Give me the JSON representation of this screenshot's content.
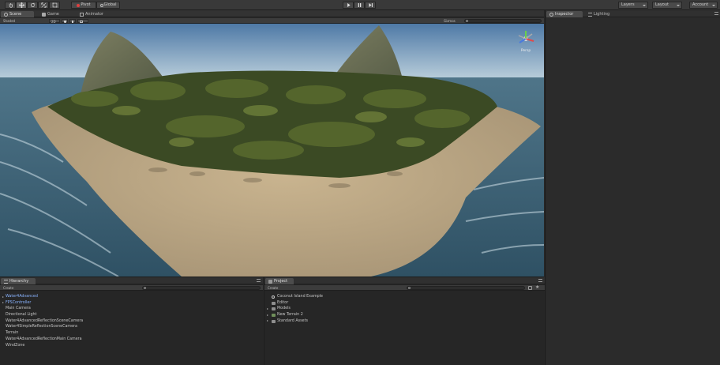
{
  "toolbar": {
    "transform_tools": [
      "hand-tool",
      "move-tool",
      "rotate-tool",
      "scale-tool",
      "rect-tool"
    ],
    "pivot_label": "Pivot",
    "global_label": "Global",
    "play_controls": [
      "play",
      "pause",
      "step"
    ],
    "layers_label": "Layers",
    "layout_label": "Layout",
    "account_label": "Account"
  },
  "scene_panel": {
    "tabs": [
      {
        "label": "Scene",
        "icon": "scene-icon"
      },
      {
        "label": "Game",
        "icon": "game-icon"
      },
      {
        "label": "Animator",
        "icon": "animator-icon"
      }
    ],
    "shading_mode": "Shaded",
    "mode_2d": "2D",
    "gizmos_label": "Gizmos",
    "gizmo_view": "Persp"
  },
  "hierarchy": {
    "tab_label": "Hierarchy",
    "create_label": "Create",
    "items": [
      {
        "label": "Water4Advanced",
        "prefab": true,
        "expandable": true
      },
      {
        "label": "FPSController",
        "prefab": true,
        "expandable": true
      },
      {
        "label": "Main Camera",
        "prefab": false,
        "expandable": false
      },
      {
        "label": "Directional Light",
        "prefab": false,
        "expandable": false
      },
      {
        "label": "Water4AdvancedReflectionSceneCamera",
        "prefab": false,
        "expandable": false
      },
      {
        "label": "Water4SimpleReflectionSceneCamera",
        "prefab": false,
        "expandable": false
      },
      {
        "label": "Terrain",
        "prefab": false,
        "expandable": false
      },
      {
        "label": "Water4AdvancedReflectionMain Camera",
        "prefab": false,
        "expandable": false
      },
      {
        "label": "WindZone",
        "prefab": false,
        "expandable": false
      }
    ]
  },
  "project": {
    "tab_label": "Project",
    "create_label": "Create",
    "items": [
      {
        "label": "Coconut Island Example",
        "icon": "unity-scene-icon",
        "expandable": false
      },
      {
        "label": "Editor",
        "icon": "folder-icon",
        "expandable": false
      },
      {
        "label": "Models",
        "icon": "folder-icon",
        "expandable": true
      },
      {
        "label": "New Terrain 2",
        "icon": "terrain-icon",
        "expandable": true
      },
      {
        "label": "Standard Assets",
        "icon": "folder-icon",
        "expandable": true
      }
    ]
  },
  "inspector": {
    "tabs": [
      {
        "label": "Inspector",
        "icon": "info-icon"
      },
      {
        "label": "Lighting",
        "icon": "lighting-icon"
      }
    ]
  },
  "colors": {
    "panel_bg": "#262626",
    "toolbar_bg": "#393939",
    "prefab_text": "#8ab4ff"
  }
}
